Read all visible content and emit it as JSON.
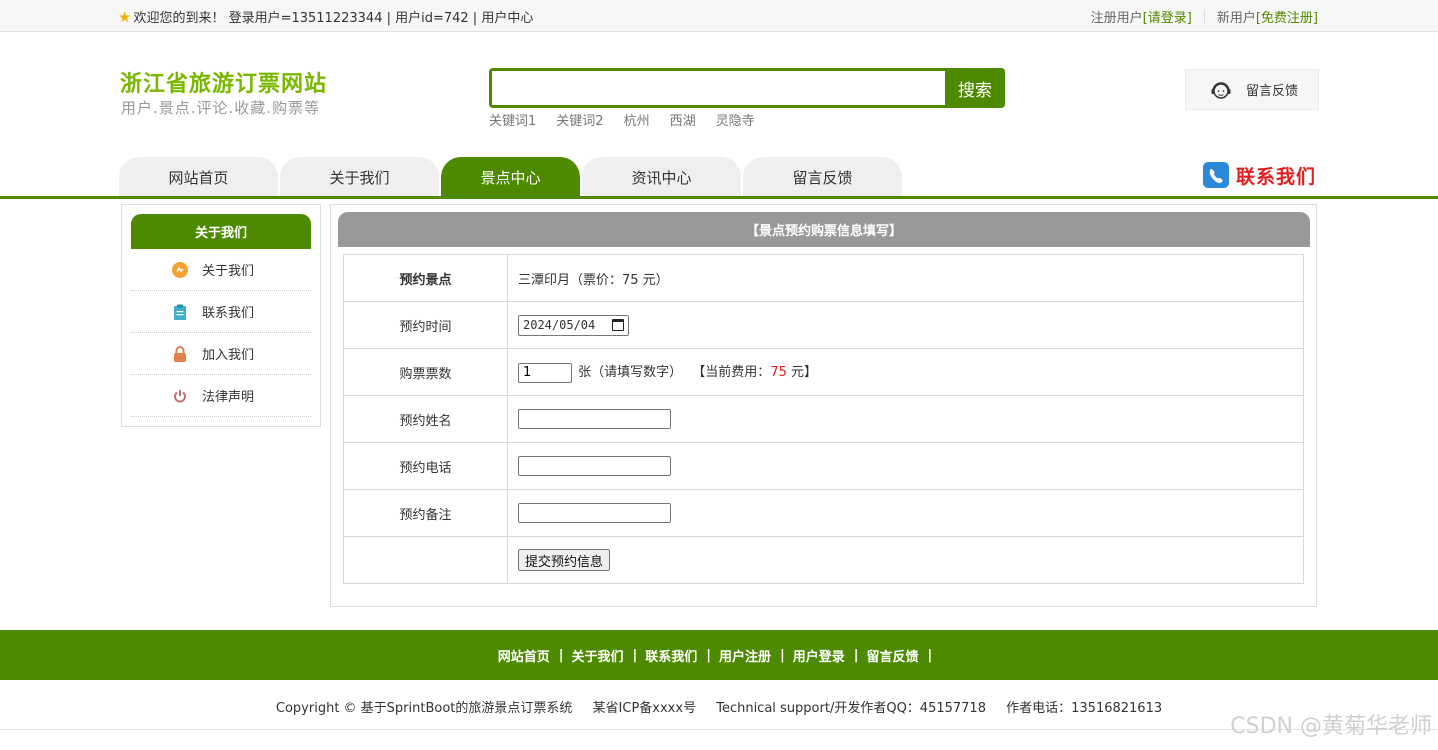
{
  "topbar": {
    "welcome": "欢迎您的到来！ 登录用户=13511223344 | 用户id=742 | 用户中心",
    "register_label": "注册用户",
    "login_link": "[请登录]",
    "new_user_label": "新用户",
    "signup_link": "[免费注册]"
  },
  "header": {
    "site_title": "浙江省旅游订票网站",
    "site_subtitle": "用户.景点.评论.收藏.购票等",
    "search_placeholder": "",
    "search_button": "搜索",
    "keywords": [
      "关键词1",
      "关键词2",
      "杭州",
      "西湖",
      "灵隐寺"
    ],
    "feedback_label": "留言反馈"
  },
  "nav": {
    "items": [
      {
        "label": "网站首页",
        "active": false
      },
      {
        "label": "关于我们",
        "active": false
      },
      {
        "label": "景点中心",
        "active": true
      },
      {
        "label": "资讯中心",
        "active": false
      },
      {
        "label": "留言反馈",
        "active": false
      }
    ],
    "contact_label": "联系我们"
  },
  "sidebar": {
    "title": "关于我们",
    "items": [
      {
        "label": "关于我们",
        "icon": "about-icon",
        "color": "#f5a030"
      },
      {
        "label": "联系我们",
        "icon": "clipboard-icon",
        "color": "#3fb0c8"
      },
      {
        "label": "加入我们",
        "icon": "lock-icon",
        "color": "#e0804a"
      },
      {
        "label": "法律声明",
        "icon": "power-icon",
        "color": "#c07070"
      }
    ]
  },
  "form": {
    "title": "【景点预约购票信息填写】",
    "rows": {
      "spot_label": "预约景点",
      "spot_value": "三潭印月（票价：75 元）",
      "time_label": "预约时间",
      "time_value": "2024/05/04",
      "count_label": "购票票数",
      "count_value": "1",
      "count_unit": "张（请填写数字）",
      "fee_prefix": "【当前费用：",
      "fee_amount": "75",
      "fee_suffix": " 元】",
      "name_label": "预约姓名",
      "phone_label": "预约电话",
      "note_label": "预约备注",
      "submit_label": "提交预约信息"
    }
  },
  "footer": {
    "links": [
      "网站首页",
      "关于我们",
      "联系我们",
      "用户注册",
      "用户登录",
      "留言反馈"
    ],
    "copyright": "Copyright © 基于SprintBoot的旅游景点订票系统",
    "icp": "某省ICP备xxxx号",
    "support": "Technical support/开发作者QQ：45157718",
    "phone": "作者电话：13516821613"
  },
  "watermark": "CSDN @黄菊华老师",
  "colors": {
    "primary_green": "#4e8a00",
    "title_green": "#7ab800",
    "accent_red": "#e02020"
  }
}
